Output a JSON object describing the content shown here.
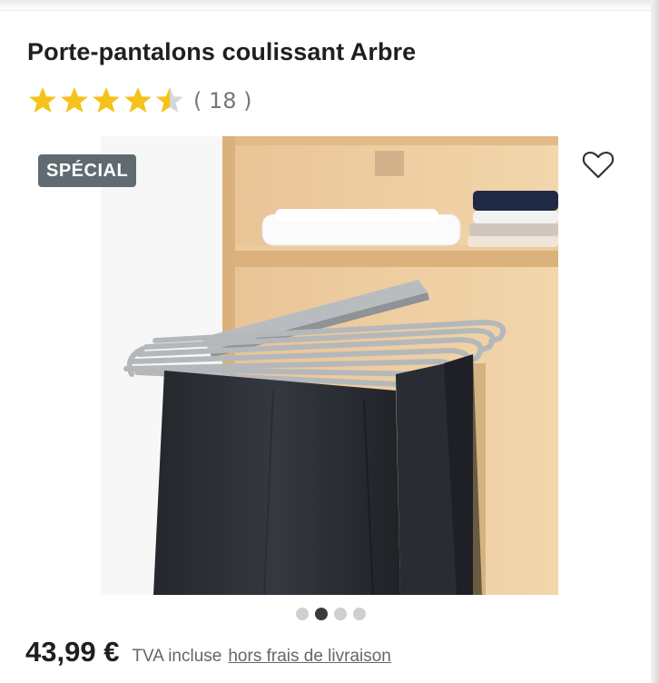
{
  "product": {
    "title": "Porte-pantalons coulissant Arbre",
    "rating": {
      "value": 4.5,
      "max": 5,
      "count_label": "( 18 )",
      "star_color": "#f5c21b",
      "empty_color": "#d7d7d7"
    },
    "badge": "SPÉCIAL",
    "image": {
      "alt": "pull-out-trouser-rack-photo"
    },
    "gallery": {
      "total": 4,
      "active_index": 1
    },
    "price": {
      "amount": "43,99 €",
      "tax_note": "TVA incluse",
      "shipping_link": "hors frais de livraison"
    }
  },
  "icons": {
    "wishlist": "heart-outline-icon",
    "star": "star-icon"
  }
}
